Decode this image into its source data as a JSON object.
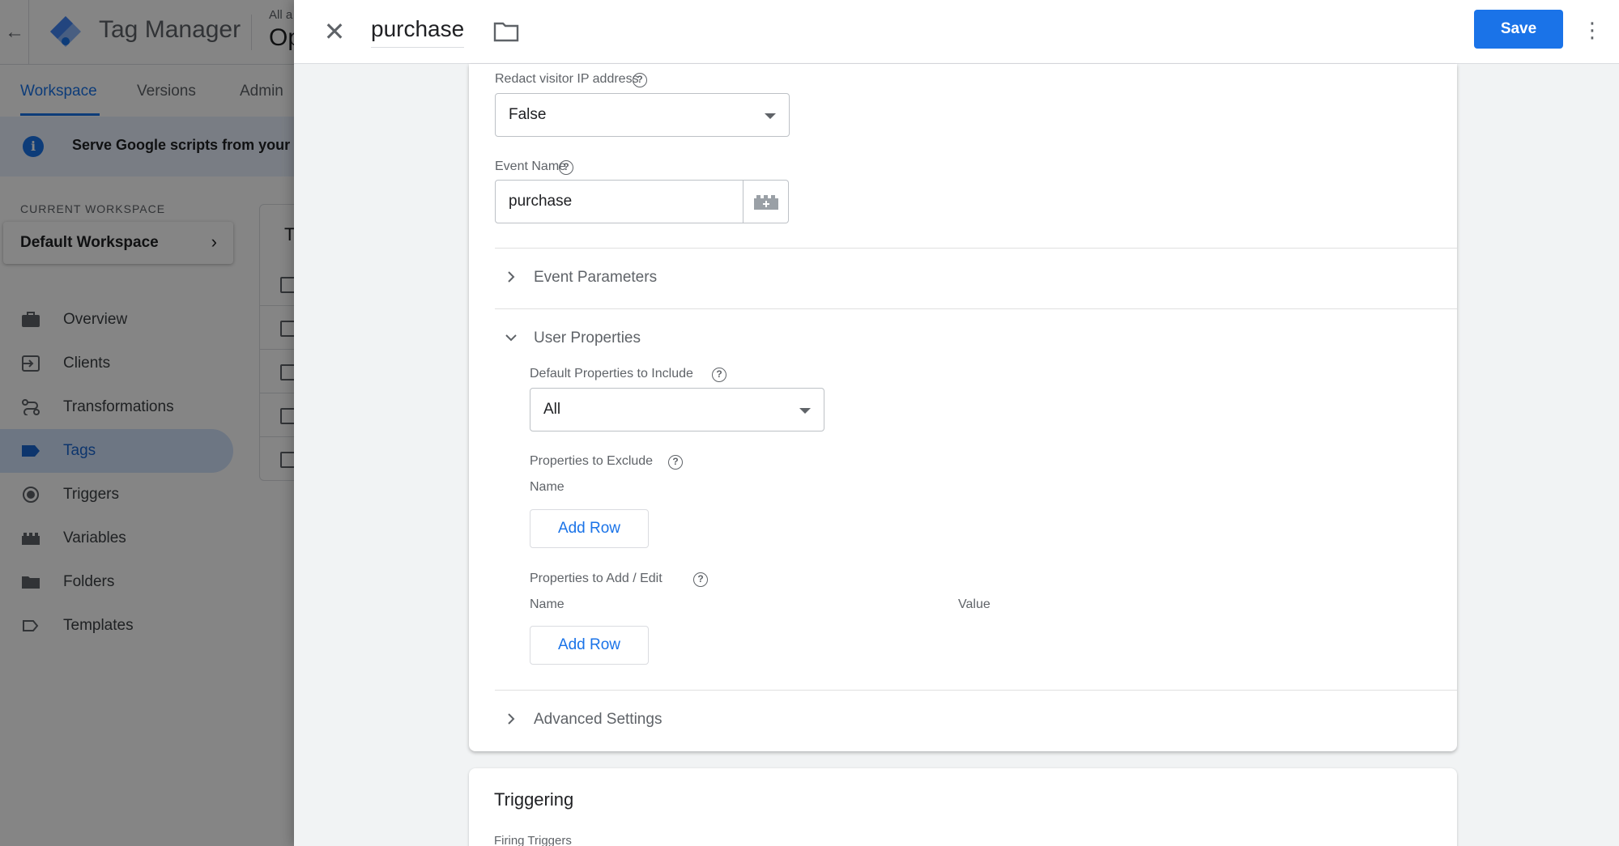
{
  "background_app": {
    "title": "Tag Manager",
    "account_small": "All a",
    "account_big": "Op",
    "tabs": [
      {
        "label": "Workspace",
        "active": true
      },
      {
        "label": "Versions",
        "active": false
      },
      {
        "label": "Admin",
        "active": false
      }
    ],
    "banner_text": "Serve Google scripts from your",
    "current_workspace_label": "CURRENT WORKSPACE",
    "current_workspace_value": "Default Workspace",
    "nav": [
      {
        "label": "Overview",
        "icon": "briefcase-icon",
        "active": false
      },
      {
        "label": "Clients",
        "icon": "login-icon",
        "active": false
      },
      {
        "label": "Transformations",
        "icon": "route-icon",
        "active": false
      },
      {
        "label": "Tags",
        "icon": "tag-icon",
        "active": true
      },
      {
        "label": "Triggers",
        "icon": "trigger-icon",
        "active": false
      },
      {
        "label": "Variables",
        "icon": "lego-icon",
        "active": false
      },
      {
        "label": "Folders",
        "icon": "folder-icon",
        "active": false
      },
      {
        "label": "Templates",
        "icon": "label-outline-icon",
        "active": false
      }
    ],
    "table_header_initial": "T"
  },
  "drawer": {
    "tag_name": "purchase",
    "save_label": "Save",
    "fields": {
      "redact_ip": {
        "label": "Redact visitor IP address",
        "value": "False"
      },
      "event_name": {
        "label": "Event Name",
        "value": "purchase"
      }
    },
    "sections": {
      "event_parameters": "Event Parameters",
      "user_properties": "User Properties",
      "advanced_settings": "Advanced Settings"
    },
    "user_properties": {
      "default_props": {
        "label": "Default Properties to Include",
        "value": "All"
      },
      "exclude": {
        "label": "Properties to Exclude",
        "col_name": "Name",
        "add_row": "Add Row"
      },
      "add_edit": {
        "label": "Properties to Add / Edit",
        "col_name": "Name",
        "col_value": "Value",
        "add_row": "Add Row"
      }
    },
    "triggering": {
      "title": "Triggering",
      "subtitle": "Firing Triggers"
    }
  },
  "colors": {
    "accent": "#1a73e8",
    "active_nav_bg": "#d2e3fc",
    "banner_bg": "#e8f0fe"
  }
}
